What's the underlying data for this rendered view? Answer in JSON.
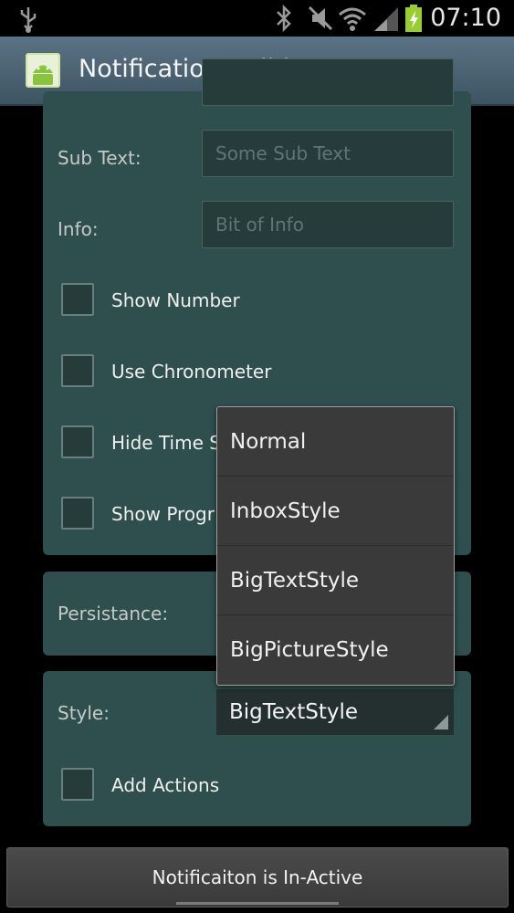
{
  "status_bar": {
    "time": "07:10",
    "icons": [
      "usb-icon",
      "bluetooth-icon",
      "mute-icon",
      "wifi-icon",
      "signal-icon",
      "battery-charging-icon"
    ]
  },
  "action_bar": {
    "title": "Notification Builder Demo",
    "icon": "android-app-icon"
  },
  "form": {
    "sub_text": {
      "label": "Sub Text:",
      "placeholder": "Some Sub Text"
    },
    "info": {
      "label": "Info:",
      "placeholder": "Bit of Info"
    },
    "checkboxes": [
      {
        "label": "Show Number",
        "checked": false
      },
      {
        "label": "Use Chronometer",
        "checked": false
      },
      {
        "label": "Hide Time S",
        "checked": false
      },
      {
        "label": "Show Progr",
        "checked": false
      }
    ],
    "persistance_label": "Persistance:",
    "style": {
      "label": "Style:",
      "selected": "BigTextStyle"
    },
    "add_actions": {
      "label": "Add Actions",
      "checked": false
    }
  },
  "style_dropdown": {
    "options": [
      "Normal",
      "InboxStyle",
      "BigTextStyle",
      "BigPictureStyle"
    ]
  },
  "bottom_button": {
    "label": "Notificaiton is In-Active"
  },
  "colors": {
    "panel": "#2e4f4d",
    "action_bar": "#4c6575",
    "dropdown": "#3a3a3a"
  }
}
